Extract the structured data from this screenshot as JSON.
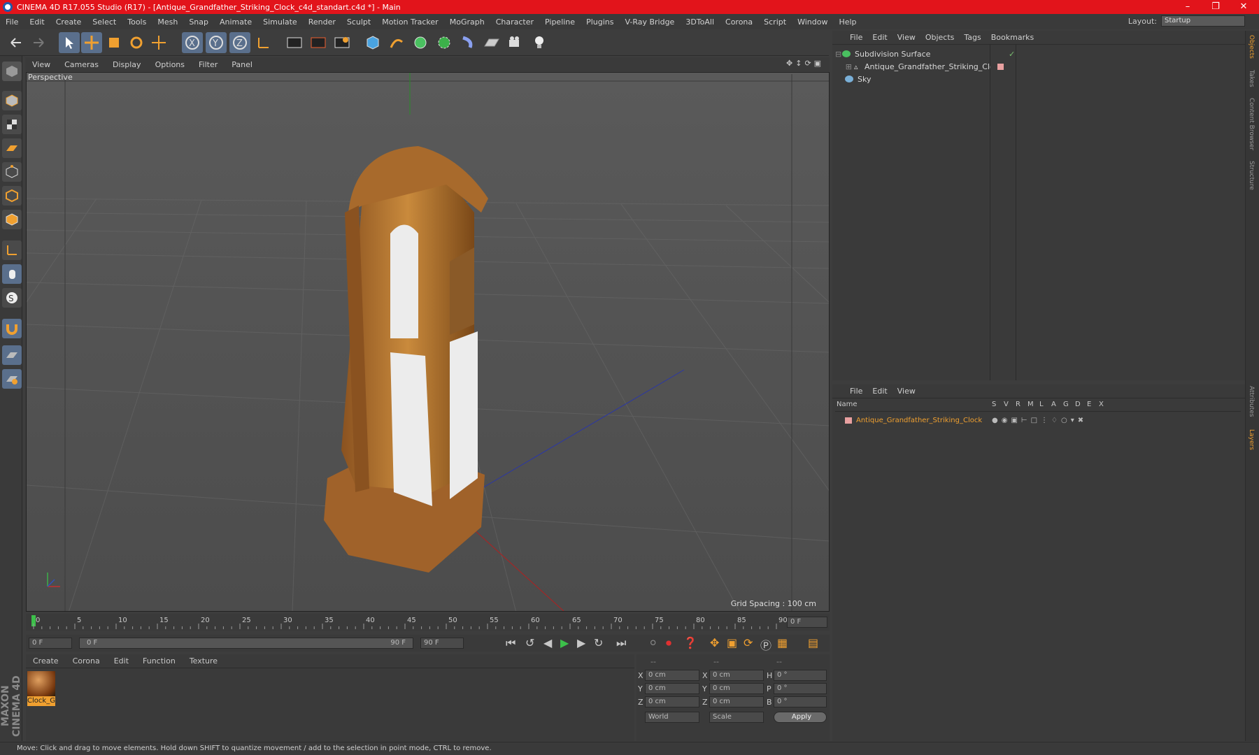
{
  "window": {
    "title": "CINEMA 4D R17.055 Studio (R17) - [Antique_Grandfather_Striking_Clock_c4d_standart.c4d *] - Main"
  },
  "menubar": {
    "items": [
      "File",
      "Edit",
      "Create",
      "Select",
      "Tools",
      "Mesh",
      "Snap",
      "Animate",
      "Simulate",
      "Render",
      "Sculpt",
      "Motion Tracker",
      "MoGraph",
      "Character",
      "Pipeline",
      "Plugins",
      "V-Ray Bridge",
      "3DToAll",
      "Corona",
      "Script",
      "Window",
      "Help"
    ]
  },
  "layout": {
    "label": "Layout:",
    "value": "Startup"
  },
  "viewport": {
    "menu": [
      "View",
      "Cameras",
      "Display",
      "Options",
      "Filter",
      "Panel"
    ],
    "label": "Perspective",
    "grid_spacing": "Grid Spacing : 100 cm"
  },
  "timeline": {
    "ticks": [
      "0",
      "5",
      "10",
      "15",
      "20",
      "25",
      "30",
      "35",
      "40",
      "45",
      "50",
      "55",
      "60",
      "65",
      "70",
      "75",
      "80",
      "85",
      "90"
    ],
    "current_frame": "0 F",
    "start": "0 F",
    "slider_start": "0 F",
    "slider_end": "90 F",
    "end": "90 F"
  },
  "material_panel": {
    "menu": [
      "Create",
      "Corona",
      "Edit",
      "Function",
      "Texture"
    ],
    "materials": [
      {
        "name": "Clock_G"
      }
    ]
  },
  "coords": {
    "headers": [
      "--",
      "--",
      "--"
    ],
    "rows": [
      {
        "a": "X",
        "av": "0 cm",
        "b": "X",
        "bv": "0 cm",
        "c": "H",
        "cv": "0 °"
      },
      {
        "a": "Y",
        "av": "0 cm",
        "b": "Y",
        "bv": "0 cm",
        "c": "P",
        "cv": "0 °"
      },
      {
        "a": "Z",
        "av": "0 cm",
        "b": "Z",
        "bv": "0 cm",
        "c": "B",
        "cv": "0 °"
      }
    ],
    "world": "World",
    "scale": "Scale",
    "apply": "Apply"
  },
  "object_manager": {
    "menu": [
      "File",
      "Edit",
      "View",
      "Objects",
      "Tags",
      "Bookmarks"
    ],
    "objects": [
      {
        "name": "Subdivision Surface"
      },
      {
        "name": "Antique_Grandfather_Striking_Clock"
      },
      {
        "name": "Sky"
      }
    ]
  },
  "layer_manager": {
    "menu": [
      "File",
      "Edit",
      "View"
    ],
    "columns": [
      "Name",
      "S",
      "V",
      "R",
      "M",
      "L",
      "A",
      "G",
      "D",
      "E",
      "X"
    ],
    "layers": [
      {
        "name": "Antique_Grandfather_Striking_Clock"
      }
    ]
  },
  "right_tabs": [
    "Objects",
    "Takes",
    "Content Browser",
    "Structure",
    "Attributes",
    "Layers"
  ],
  "brand": "MAXON CINEMA 4D",
  "status": "Move: Click and drag to move elements. Hold down SHIFT to quantize movement / add to the selection in point mode, CTRL to remove.",
  "colors": {
    "titlebar": "#e2141b",
    "accent": "#f0a030",
    "selected_tool": "#5a6f8c"
  }
}
